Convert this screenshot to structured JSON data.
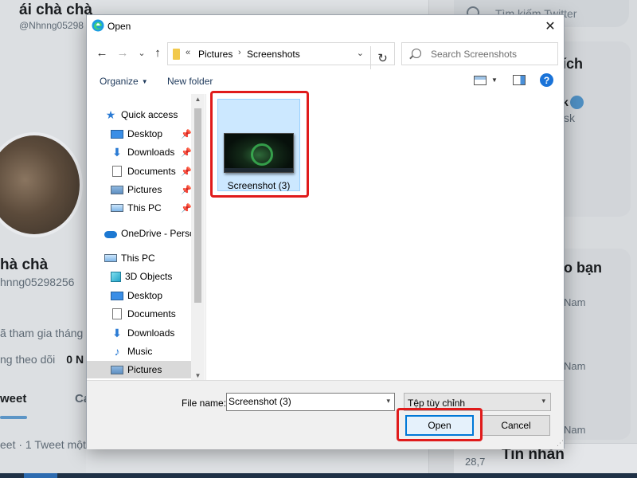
{
  "background": {
    "profile_name": "ái chà chà",
    "profile_handle": "@Nhnng05298",
    "profile_name_partial": "hà chà",
    "profile_handle_partial": "hnng05298256",
    "joined_partial": "ã tham gia tháng",
    "following_partial": "ng theo dõi",
    "followers_count": "0 N",
    "tab_tweet_partial": "weet",
    "tab_other_partial": "Ca",
    "tweet_count_partial": "eet · 1 Tweet một",
    "search_placeholder": "Tìm kiếm Twitter",
    "right_heading_partial": "ích",
    "right_name_partial": "k",
    "right_sub_partial": "sk",
    "right_section_partial": "o bạn",
    "right_nam": "Nam",
    "messages_title": "Tin nhắn",
    "messages_count_partial": "28,7"
  },
  "dialog": {
    "title": "Open",
    "close_glyph": "✕",
    "nav": {
      "back_glyph": "←",
      "forward_glyph": "→",
      "recent_glyph": "⌄",
      "up_glyph": "↑",
      "breadcrumb_prefix": "«",
      "breadcrumb": [
        "Pictures",
        "Screenshots"
      ],
      "separator": "›",
      "address_dropdown_glyph": "⌄",
      "refresh_glyph": "↻",
      "search_placeholder": "Search Screenshots"
    },
    "commands": {
      "organize": "Organize",
      "organize_caret": "▼",
      "new_folder": "New folder",
      "view_caret": "▼",
      "help_glyph": "?"
    },
    "sidebar": {
      "items": [
        {
          "label": "Quick access",
          "icon": "star-icon",
          "pinned": false
        },
        {
          "label": "Desktop",
          "icon": "desktop-icon",
          "pinned": true
        },
        {
          "label": "Downloads",
          "icon": "download-icon",
          "pinned": true
        },
        {
          "label": "Documents",
          "icon": "documents-icon",
          "pinned": true
        },
        {
          "label": "Pictures",
          "icon": "pictures-icon",
          "pinned": true
        },
        {
          "label": "This PC",
          "icon": "computer-icon",
          "pinned": true
        },
        {
          "label": "OneDrive - Person",
          "icon": "cloud-icon",
          "pinned": false
        },
        {
          "label": "This PC",
          "icon": "computer-icon",
          "pinned": false
        },
        {
          "label": "3D Objects",
          "icon": "3d-objects-icon",
          "pinned": false
        },
        {
          "label": "Desktop",
          "icon": "desktop-icon",
          "pinned": false
        },
        {
          "label": "Documents",
          "icon": "documents-icon",
          "pinned": false
        },
        {
          "label": "Downloads",
          "icon": "download-icon",
          "pinned": false
        },
        {
          "label": "Music",
          "icon": "music-icon",
          "pinned": false
        },
        {
          "label": "Pictures",
          "icon": "pictures-icon",
          "pinned": false,
          "selected": true
        }
      ],
      "pin_glyph": "📌",
      "scroll_up_glyph": "▲",
      "scroll_down_glyph": "▼"
    },
    "files": [
      {
        "name": "Screenshot (3)",
        "selected": true
      }
    ],
    "footer": {
      "filename_label": "File name:",
      "filename_value": "Screenshot (3)",
      "filename_dropdown_glyph": "▾",
      "filetype_value": "Tệp tùy chỉnh",
      "filetype_dropdown_glyph": "▾",
      "open_label": "Open",
      "cancel_label": "Cancel",
      "grip_glyph": "⋰"
    }
  },
  "colors": {
    "highlight_red": "#e01b1b",
    "selection_blue": "#cce8ff",
    "accent_blue": "#0078d7"
  }
}
